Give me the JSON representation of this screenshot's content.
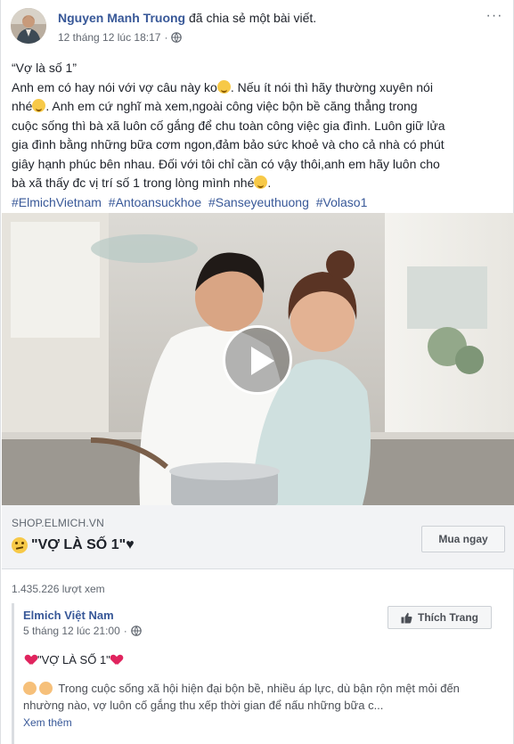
{
  "post": {
    "author": "Nguyen Manh Truong",
    "shared_text": "đã chia sẻ một bài viết.",
    "timestamp": "12 tháng 12 lúc 18:17",
    "separator": "·",
    "more_label": "···",
    "body": {
      "title": "“Vợ là số 1”",
      "line1": "Anh em có hay nói với vợ câu này ko",
      "line1_after": ". Nếu ít nói thì hãy thường xuyên nói",
      "line2": "nhé",
      "line2_after": ". Anh em cứ nghĩ mà xem,ngoài công việc bộn bề căng thẳng trong",
      "line3": "cuộc sống thì bà xã luôn cố gắng để chu toàn công việc gia đình. Luôn giữ lửa",
      "line4": "gia đình bằng những bữa cơm ngon,đảm bảo sức khoẻ và cho cả nhà có phút",
      "line5": "giây hạnh phúc bên nhau. Đối với tôi chỉ cần có vậy thôi,anh em hãy luôn cho",
      "line6": "bà xã thấy đc vị trí số 1 trong lòng mình nhé",
      "line6_after": ".",
      "hashtags": [
        "#ElmichVietnam",
        "#Antoansuckhoe",
        "#Sanseyeuthuong",
        "#Volaso1"
      ]
    }
  },
  "link_card": {
    "domain": "SHOP.ELMICH.VN",
    "title": "\"VỢ LÀ SỐ 1\"♥",
    "cta_label": "Mua ngay"
  },
  "views_text": "1.435.226 lượt xem",
  "shared_post": {
    "page_name": "Elmich Việt Nam",
    "timestamp": "5 tháng 12 lúc 21:00",
    "separator": "·",
    "like_page_label": "Thích Trang",
    "title": "\"VỢ LÀ SỐ 1\"",
    "text_line1": "Trong cuộc sống xã hội hiện đại bộn bề, nhiều áp lực, dù bận rộn mệt mỏi đến",
    "text_line2": "nhường nào, vợ luôn cố gắng thu xếp thời gian để nấu những bữa c...",
    "see_more": "Xem thêm"
  },
  "colors": {
    "link_blue": "#385898",
    "text": "#1d2129",
    "muted": "#606770",
    "card_bg": "#f2f3f5"
  }
}
